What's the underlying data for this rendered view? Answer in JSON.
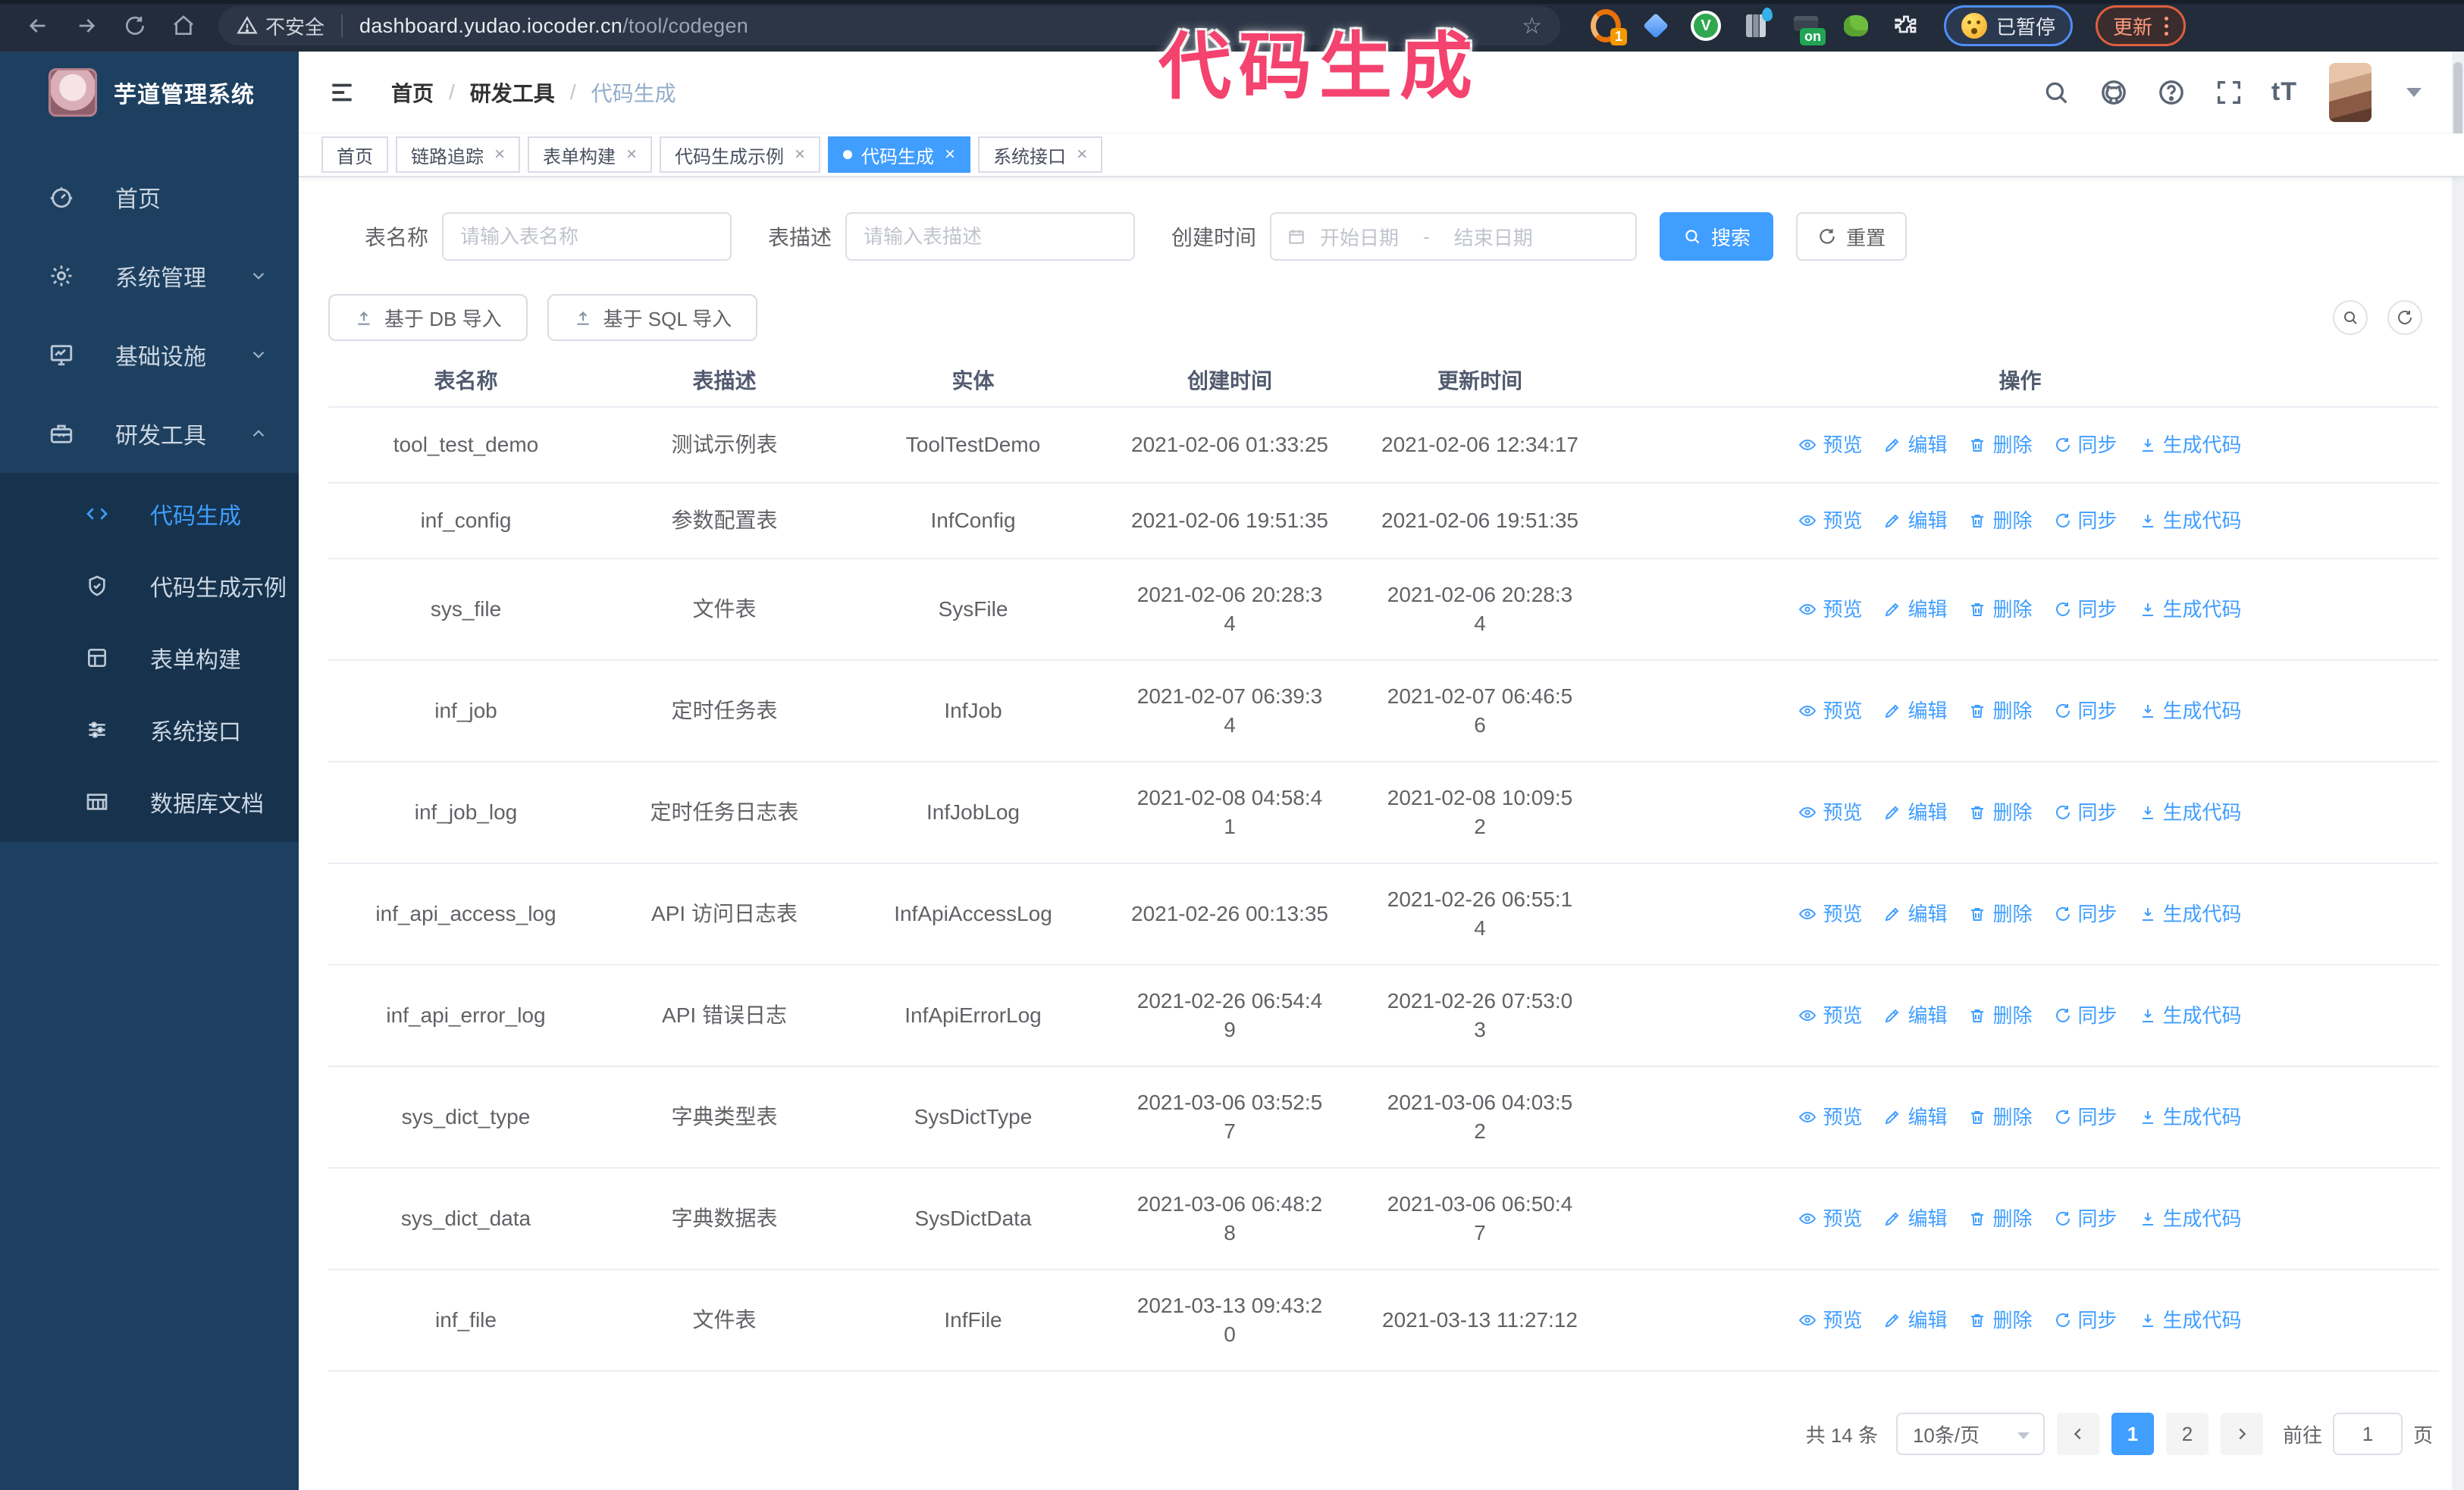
{
  "browser": {
    "warning": "不安全",
    "url_domain": "dashboard.yudao.iocoder.cn",
    "url_path": "/tool/codegen",
    "paused": "已暂停",
    "update": "更新",
    "extensions": [
      {
        "icon": "loop-ext-icon",
        "badge": "1"
      },
      {
        "icon": "gem-ext-icon"
      },
      {
        "icon": "v-ext-icon"
      },
      {
        "icon": "columns-ext-icon"
      },
      {
        "icon": "tag-ext-icon",
        "badge": "on"
      },
      {
        "icon": "frog-ext-icon"
      },
      {
        "icon": "puzzle-ext-icon"
      }
    ]
  },
  "annotation": {
    "text": "代码生成",
    "color": "#f4436e"
  },
  "sidebar": {
    "title": "芋道管理系统",
    "items": [
      {
        "id": "home",
        "label": "首页",
        "icon": "dashboard-icon"
      },
      {
        "id": "system",
        "label": "系统管理",
        "icon": "gear-icon",
        "chevron": "down"
      },
      {
        "id": "infra",
        "label": "基础设施",
        "icon": "monitor-icon",
        "chevron": "down"
      },
      {
        "id": "dev-tools",
        "label": "研发工具",
        "icon": "toolbox-icon",
        "chevron": "up",
        "children": [
          {
            "id": "codegen",
            "label": "代码生成",
            "icon": "code-icon",
            "active": true
          },
          {
            "id": "codegen-demo",
            "label": "代码生成示例",
            "icon": "shield-icon"
          },
          {
            "id": "form-builder",
            "label": "表单构建",
            "icon": "form-icon"
          },
          {
            "id": "api",
            "label": "系统接口",
            "icon": "sliders-icon"
          },
          {
            "id": "db-doc",
            "label": "数据库文档",
            "icon": "tablegrid-icon"
          }
        ]
      }
    ]
  },
  "header": {
    "breadcrumb": [
      "首页",
      "研发工具",
      "代码生成"
    ],
    "icons": [
      "search-icon",
      "github-icon",
      "help-icon",
      "fullscreen-icon",
      "fontsize-icon"
    ]
  },
  "tabs": [
    {
      "id": "home",
      "label": "首页",
      "closable": false,
      "active": false
    },
    {
      "id": "trace",
      "label": "链路追踪",
      "closable": true,
      "active": false
    },
    {
      "id": "form-builder",
      "label": "表单构建",
      "closable": true,
      "active": false
    },
    {
      "id": "codegen-demo",
      "label": "代码生成示例",
      "closable": true,
      "active": false
    },
    {
      "id": "codegen",
      "label": "代码生成",
      "closable": true,
      "active": true
    },
    {
      "id": "api",
      "label": "系统接口",
      "closable": true,
      "active": false
    }
  ],
  "filters": {
    "name_label": "表名称",
    "name_placeholder": "请输入表名称",
    "desc_label": "表描述",
    "desc_placeholder": "请输入表描述",
    "time_label": "创建时间",
    "start_placeholder": "开始日期",
    "range_separator": "-",
    "end_placeholder": "结束日期",
    "search_label": "搜索",
    "reset_label": "重置"
  },
  "toolbar": {
    "db_import": "基于 DB 导入",
    "sql_import": "基于 SQL 导入"
  },
  "table": {
    "columns": [
      "表名称",
      "表描述",
      "实体",
      "创建时间",
      "更新时间",
      "操作"
    ],
    "actions": [
      {
        "label": "预览",
        "icon": "eye-icon"
      },
      {
        "label": "编辑",
        "icon": "edit-icon"
      },
      {
        "label": "删除",
        "icon": "delete-icon"
      },
      {
        "label": "同步",
        "icon": "sync-icon"
      },
      {
        "label": "生成代码",
        "icon": "download-icon"
      }
    ],
    "rows": [
      {
        "name": "tool_test_demo",
        "desc": "测试示例表",
        "entity": "ToolTestDemo",
        "created": [
          "2021-02-06 01:33:25"
        ],
        "updated": [
          "2021-02-06 12:34:17"
        ]
      },
      {
        "name": "inf_config",
        "desc": "参数配置表",
        "entity": "InfConfig",
        "created": [
          "2021-02-06 19:51:35"
        ],
        "updated": [
          "2021-02-06 19:51:35"
        ]
      },
      {
        "name": "sys_file",
        "desc": "文件表",
        "entity": "SysFile",
        "created": [
          "2021-02-06 20:28:3",
          "4"
        ],
        "updated": [
          "2021-02-06 20:28:3",
          "4"
        ]
      },
      {
        "name": "inf_job",
        "desc": "定时任务表",
        "entity": "InfJob",
        "created": [
          "2021-02-07 06:39:3",
          "4"
        ],
        "updated": [
          "2021-02-07 06:46:5",
          "6"
        ]
      },
      {
        "name": "inf_job_log",
        "desc": "定时任务日志表",
        "entity": "InfJobLog",
        "created": [
          "2021-02-08 04:58:4",
          "1"
        ],
        "updated": [
          "2021-02-08 10:09:5",
          "2"
        ]
      },
      {
        "name": "inf_api_access_log",
        "desc": "API 访问日志表",
        "entity": "InfApiAccessLog",
        "created": [
          "2021-02-26 00:13:35"
        ],
        "updated": [
          "2021-02-26 06:55:1",
          "4"
        ]
      },
      {
        "name": "inf_api_error_log",
        "desc": "API 错误日志",
        "entity": "InfApiErrorLog",
        "created": [
          "2021-02-26 06:54:4",
          "9"
        ],
        "updated": [
          "2021-02-26 07:53:0",
          "3"
        ]
      },
      {
        "name": "sys_dict_type",
        "desc": "字典类型表",
        "entity": "SysDictType",
        "created": [
          "2021-03-06 03:52:5",
          "7"
        ],
        "updated": [
          "2021-03-06 04:03:5",
          "2"
        ]
      },
      {
        "name": "sys_dict_data",
        "desc": "字典数据表",
        "entity": "SysDictData",
        "created": [
          "2021-03-06 06:48:2",
          "8"
        ],
        "updated": [
          "2021-03-06 06:50:4",
          "7"
        ]
      },
      {
        "name": "inf_file",
        "desc": "文件表",
        "entity": "InfFile",
        "created": [
          "2021-03-13 09:43:2",
          "0"
        ],
        "updated": [
          "2021-03-13 11:27:12"
        ]
      }
    ]
  },
  "pagination": {
    "total": "共 14 条",
    "page_size": "10条/页",
    "pages": [
      {
        "label": "1",
        "active": true
      },
      {
        "label": "2",
        "active": false
      }
    ],
    "goto_label": "前往",
    "goto_value": "1",
    "page_unit": "页"
  },
  "colors": {
    "primary": "#409eff",
    "sidebar_bg": "#1e4060",
    "submenu_bg": "#16324c"
  }
}
